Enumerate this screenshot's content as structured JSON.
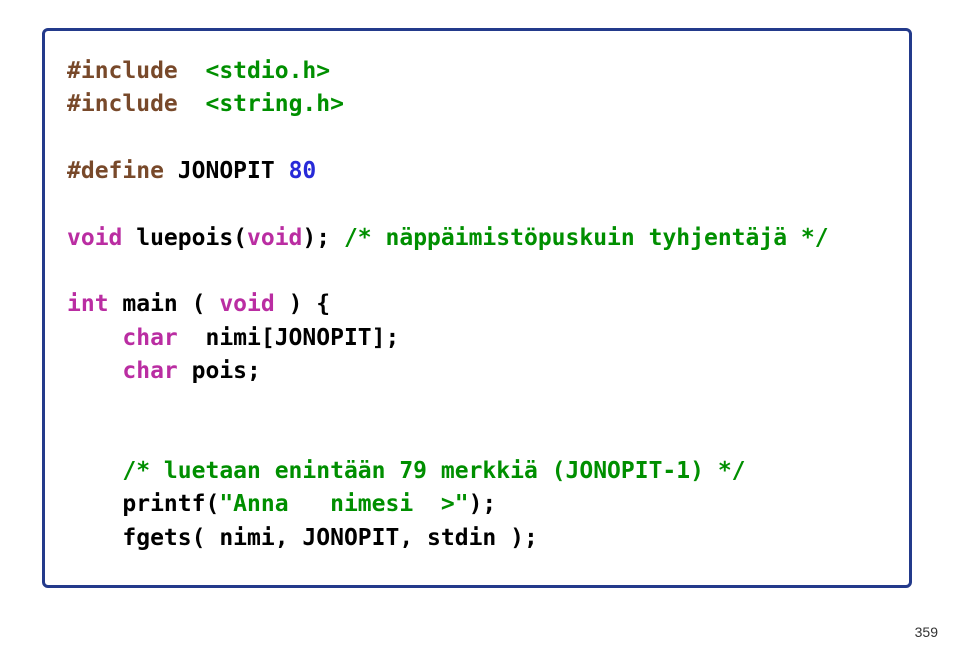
{
  "code": {
    "l01_a": "#include",
    "l01_b": "<stdio.h>",
    "l02_a": "#include",
    "l02_b": "<string.h>",
    "l04_a": "#define",
    "l04_b": " JONOPIT ",
    "l04_c": "80",
    "l06_a": "void",
    "l06_b": " luepois(",
    "l06_c": "void",
    "l06_d": "); ",
    "l06_e": "/* näppäimistöpuskuin tyhjentäjä */",
    "l08_a": "int",
    "l08_b": " main ( ",
    "l08_c": "void",
    "l08_d": " ) {",
    "l09_a": "    ",
    "l09_b": "char",
    "l09_c": "  nimi[JONOPIT];",
    "l10_a": "    ",
    "l10_b": "char",
    "l10_c": " pois;",
    "l13_a": "    ",
    "l13_b": "/* luetaan enintään 79 merkkiä (JONOPIT-1) */",
    "l14_a": "    printf(",
    "l14_b": "\"Anna   nimesi  >\"",
    "l14_c": ");",
    "l15_a": "    fgets( nimi, JONOPIT, stdin );"
  },
  "page_number": "359"
}
